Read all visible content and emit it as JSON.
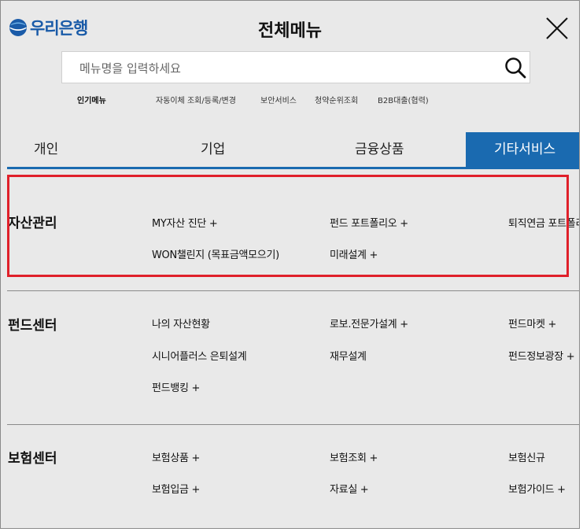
{
  "brand": {
    "name": "우리은행"
  },
  "header": {
    "title": "전체메뉴"
  },
  "search": {
    "placeholder": "메뉴명을 입력하세요"
  },
  "popular": {
    "label": "인기메뉴",
    "items": [
      "자동이체 조회/등록/변경",
      "보안서비스",
      "청약순위조회",
      "B2B대출(협력)"
    ]
  },
  "tabs": [
    {
      "label": "개인"
    },
    {
      "label": "기업"
    },
    {
      "label": "금융상품"
    },
    {
      "label": "기타서비스"
    }
  ],
  "sections": [
    {
      "title": "자산관리",
      "links": [
        "MY자산 진단 +",
        "펀드 포트폴리오 +",
        "퇴직연금 포트폴리오 +",
        "WON챌린지 (목표금액모으기)",
        "미래설계 +"
      ]
    },
    {
      "title": "펀드센터",
      "links": [
        "나의 자산현황",
        "로보.전문가설계 +",
        "펀드마켓 +",
        "시니어플러스 은퇴설계",
        "재무설계",
        "펀드정보광장 +",
        "펀드뱅킹 +"
      ]
    },
    {
      "title": "보험센터",
      "links": [
        "보험상품 +",
        "보험조회 +",
        "보험신규",
        "보험입금 +",
        "자료실 +",
        "보험가이드 +"
      ]
    }
  ],
  "colors": {
    "brand": "#1a5ba8",
    "active_tab": "#1a6ab0",
    "highlight": "#e0202a",
    "background": "#e9e9e9"
  },
  "icons": {
    "logo": "woori-logo-icon",
    "close": "close-icon",
    "search": "search-icon"
  }
}
